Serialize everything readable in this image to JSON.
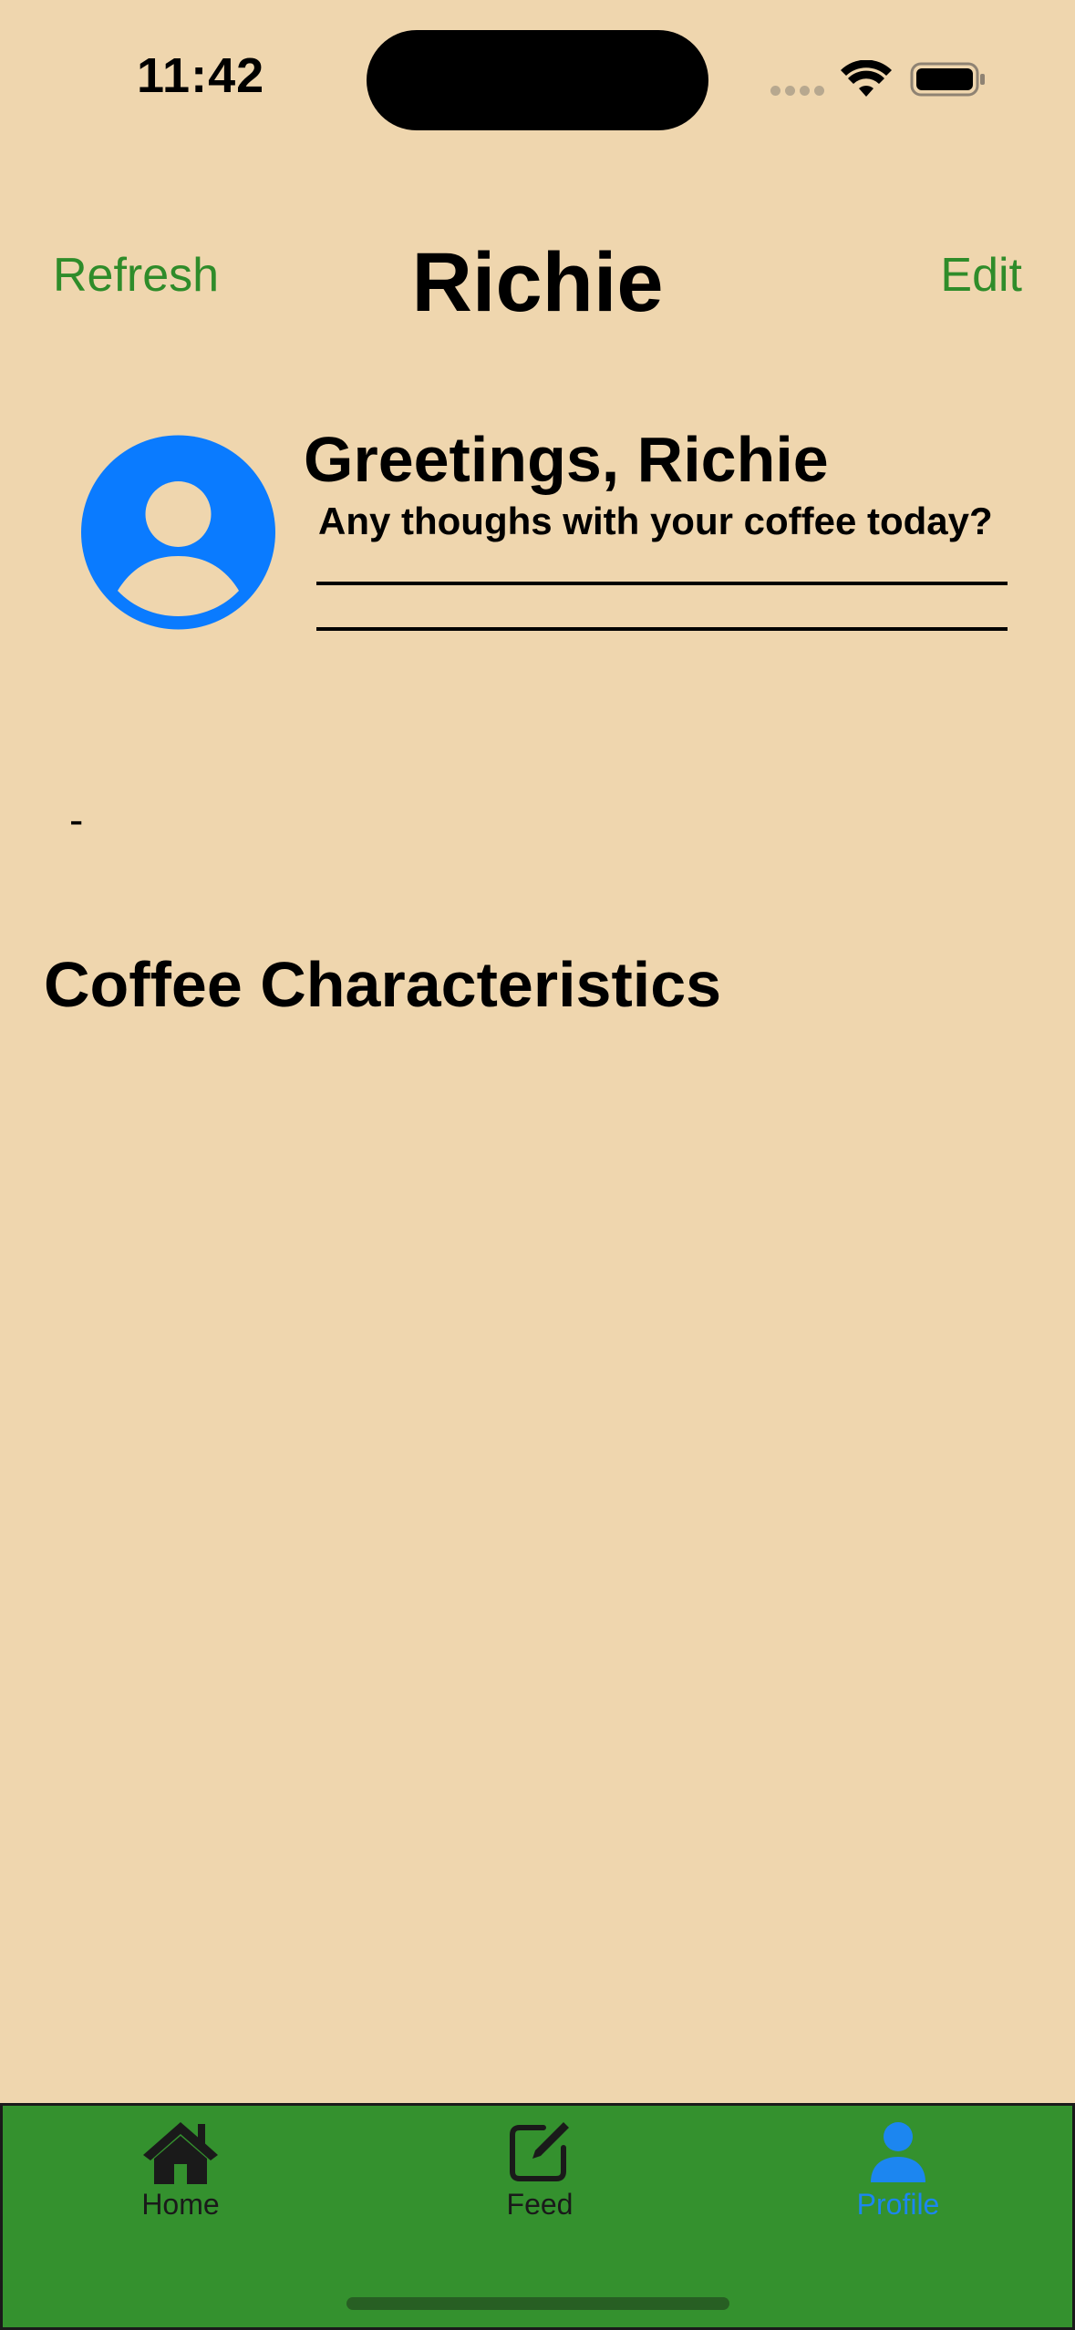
{
  "status_bar": {
    "time": "11:42"
  },
  "nav": {
    "left_button": "Refresh",
    "title": "Richie",
    "right_button": "Edit"
  },
  "profile": {
    "greeting": "Greetings, Richie",
    "prompt": "Any thoughs with your coffee today?",
    "bio": "-"
  },
  "sections": {
    "coffee_title": "Coffee Characteristics"
  },
  "tabs": [
    {
      "label": "Home",
      "icon": "house-icon",
      "selected": false
    },
    {
      "label": "Feed",
      "icon": "compose-icon",
      "selected": false
    },
    {
      "label": "Profile",
      "icon": "person-icon",
      "selected": true
    }
  ],
  "colors": {
    "background": "#efd6ae",
    "accent_green": "#2f8c2a",
    "tab_bar_green": "#34912e",
    "selected_blue": "#1c86f0",
    "avatar_blue": "#0a7bff"
  }
}
